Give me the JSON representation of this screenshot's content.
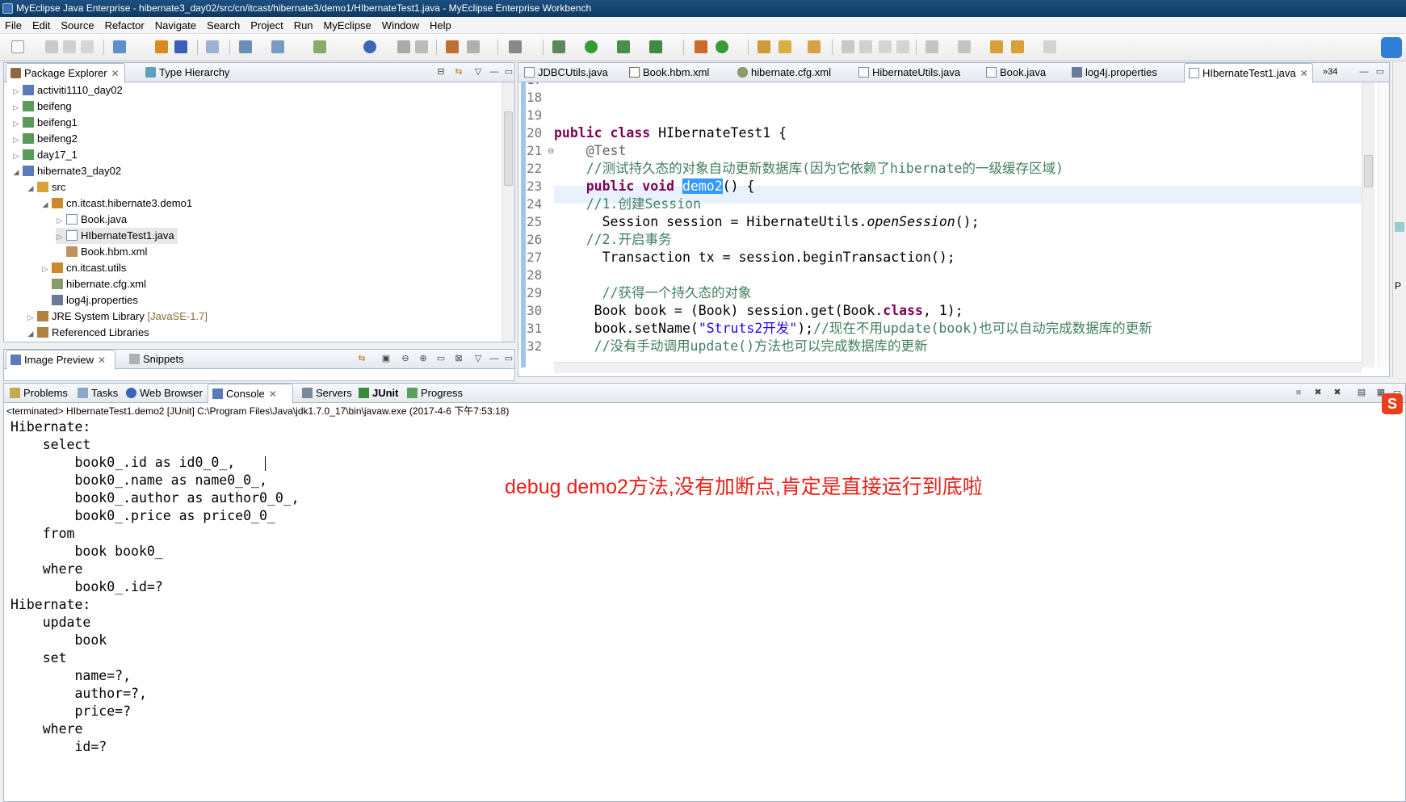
{
  "window": {
    "title": "MyEclipse Java Enterprise - hibernate3_day02/src/cn/itcast/hibernate3/demo1/HIbernateTest1.java - MyEclipse Enterprise Workbench"
  },
  "menu": [
    "File",
    "Edit",
    "Source",
    "Refactor",
    "Navigate",
    "Search",
    "Project",
    "Run",
    "MyEclipse",
    "Window",
    "Help"
  ],
  "package_explorer": {
    "tabs": [
      "Package Explorer",
      "Type Hierarchy"
    ],
    "tree": [
      {
        "label": "activiti1110_day02",
        "suffix": ""
      },
      {
        "label": "beifeng",
        "suffix": ""
      },
      {
        "label": "beifeng1",
        "suffix": ""
      },
      {
        "label": "beifeng2",
        "suffix": ""
      },
      {
        "label": "day17_1",
        "suffix": ""
      },
      {
        "label": "hibernate3_day02",
        "suffix": ""
      },
      {
        "label": "src",
        "suffix": ""
      },
      {
        "label": "cn.itcast.hibernate3.demo1",
        "suffix": ""
      },
      {
        "label": "Book.java",
        "suffix": ""
      },
      {
        "label": "HIbernateTest1.java",
        "suffix": ""
      },
      {
        "label": "Book.hbm.xml",
        "suffix": ""
      },
      {
        "label": "cn.itcast.utils",
        "suffix": ""
      },
      {
        "label": "hibernate.cfg.xml",
        "suffix": ""
      },
      {
        "label": "log4j.properties",
        "suffix": ""
      },
      {
        "label": "JRE System Library",
        "suffix": "[JavaSE-1.7]"
      },
      {
        "label": "Referenced Libraries",
        "suffix": ""
      }
    ]
  },
  "image_preview": {
    "tabs": [
      "Image Preview",
      "Snippets"
    ]
  },
  "editor": {
    "tabs": [
      "JDBCUtils.java",
      "Book.hbm.xml",
      "hibernate.cfg.xml",
      "HibernateUtils.java",
      "Book.java",
      "log4j.properties",
      "HIbernateTest1.java"
    ],
    "overflow": "»34",
    "lines": [
      "17",
      "18",
      "19",
      "20",
      "21",
      "22",
      "23",
      "24",
      "25",
      "26",
      "27",
      "28",
      "29",
      "30",
      "31",
      "32"
    ],
    "code": {
      "l20a": "public class",
      "l20b": " HIbernateTest1 {",
      "l21": "@Test",
      "l22": "//测试持久态的对象自动更新数据库(因为它依赖了hibernate的一级缓存区域)",
      "l23a": "public void",
      "l23sel": "demo2",
      "l23b": "() {",
      "l24": "//1.创建Session",
      "l25a": "Session session = HibernateUtils.",
      "l25b": "openSession",
      "l25c": "();",
      "l26": "//2.开启事务",
      "l27": "Transaction tx = session.beginTransaction();",
      "l29": "//获得一个持久态的对象",
      "l30a": "Book book = (Book) session.get(Book.",
      "l30b": "class",
      "l30c": ", 1);",
      "l31a": "book.setName(",
      "l31b": "\"Struts2开发\"",
      "l31c": ");",
      "l31d": "//现在不用update(book)也可以自动完成数据库的更新",
      "l32": "//没有手动调用update()方法也可以完成数据库的更新"
    }
  },
  "bottom": {
    "tabs": [
      "Problems",
      "Tasks",
      "Web Browser",
      "Console",
      "Servers",
      "JUnit",
      "Progress"
    ],
    "status": "<terminated> HIbernateTest1.demo2 [JUnit] C:\\Program Files\\Java\\jdk1.7.0_17\\bin\\javaw.exe (2017-4-6 下午7:53:18)",
    "console": [
      "Hibernate: ",
      "    select",
      "        book0_.id as id0_0_,",
      "        book0_.name as name0_0_,",
      "        book0_.author as author0_0_,",
      "        book0_.price as price0_0_ ",
      "    from",
      "        book book0_ ",
      "    where",
      "        book0_.id=?",
      "Hibernate: ",
      "    update",
      "        book ",
      "    set",
      "        name=?,",
      "        author=?,",
      "        price=? ",
      "    where",
      "        id=?"
    ],
    "annotation": "debug demo2方法,没有加断点,肯定是直接运行到底啦"
  },
  "right_trim": {
    "label": "P"
  },
  "colors": {
    "accent": "#3399ff",
    "annotation": "#e8201a",
    "keyword": "#7f0055",
    "comment": "#3f7f5f",
    "string": "#2a00ff"
  }
}
